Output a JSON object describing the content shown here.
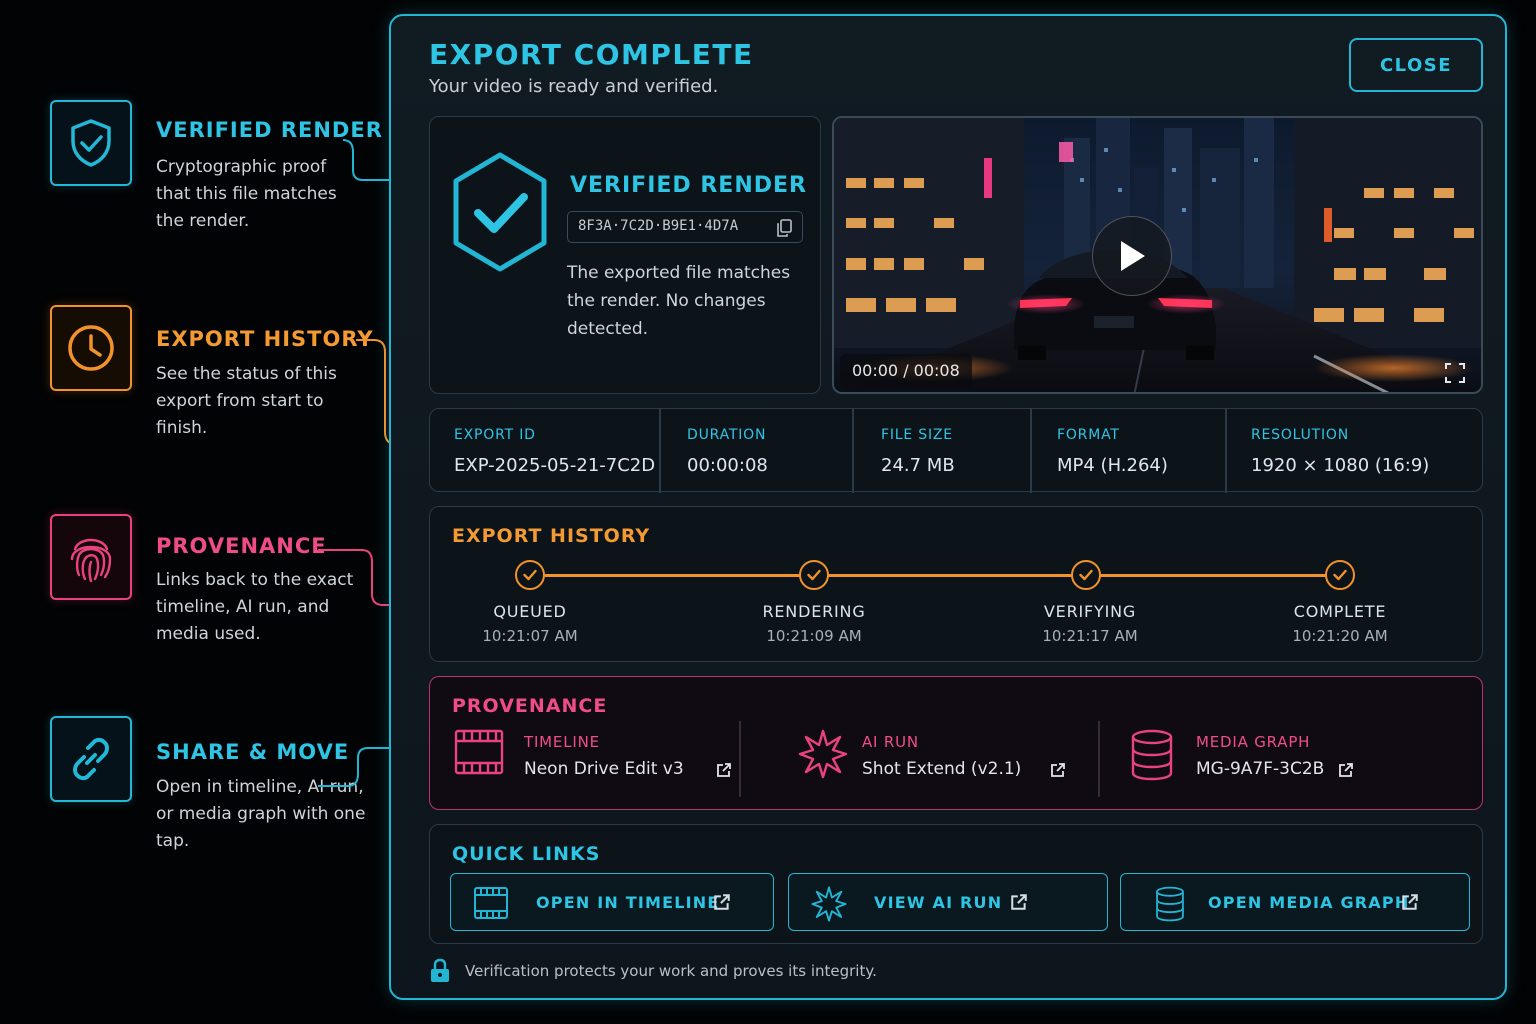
{
  "colors": {
    "cyan": "#22b6d4",
    "orange": "#f2922a",
    "pink": "#e8437e",
    "panel_bg": "#111b22",
    "page_bg": "#020304"
  },
  "annotations": [
    {
      "icon": "shield-check-icon",
      "title": "VERIFIED RENDER",
      "body": "Cryptographic proof that this file matches the render."
    },
    {
      "icon": "clock-icon",
      "title": "EXPORT HISTORY",
      "body": "See the status of this export from start to finish."
    },
    {
      "icon": "fingerprint-icon",
      "title": "PROVENANCE",
      "body": "Links back to the exact timeline, AI run, and media used."
    },
    {
      "icon": "link-icon",
      "title": "SHARE & MOVE",
      "body": "Open in timeline, AI run, or media graph with one tap."
    }
  ],
  "panel": {
    "title": "EXPORT COMPLETE",
    "subtitle": "Your video is ready and verified.",
    "close_label": "CLOSE"
  },
  "verified": {
    "title": "VERIFIED RENDER",
    "hash": "8F3A·7C2D·B9E1·4D7A",
    "description": "The exported file matches the render. No changes detected."
  },
  "video": {
    "timecode": "00:00 / 00:08",
    "progress": 0
  },
  "stats": [
    {
      "key": "EXPORT ID",
      "value": "EXP-2025-05-21-7C2D"
    },
    {
      "key": "DURATION",
      "value": "00:00:08"
    },
    {
      "key": "FILE SIZE",
      "value": "24.7 MB"
    },
    {
      "key": "FORMAT",
      "value": "MP4 (H.264)"
    },
    {
      "key": "RESOLUTION",
      "value": "1920 × 1080 (16:9)"
    }
  ],
  "history": {
    "title": "EXPORT HISTORY",
    "steps": [
      {
        "label": "QUEUED",
        "time": "10:21:07 AM"
      },
      {
        "label": "RENDERING",
        "time": "10:21:09 AM"
      },
      {
        "label": "VERIFYING",
        "time": "10:21:17 AM"
      },
      {
        "label": "COMPLETE",
        "time": "10:21:20 AM"
      }
    ]
  },
  "provenance": {
    "title": "PROVENANCE",
    "items": [
      {
        "icon": "film-strip-icon",
        "key": "TIMELINE",
        "value": "Neon Drive Edit v3"
      },
      {
        "icon": "sparkle-burst-icon",
        "key": "AI RUN",
        "value": "Shot Extend (v2.1)"
      },
      {
        "icon": "database-icon",
        "key": "MEDIA GRAPH",
        "value": "MG-9A7F-3C2B"
      }
    ]
  },
  "quick_links": {
    "title": "QUICK LINKS",
    "buttons": [
      {
        "icon": "film-strip-icon",
        "label": "OPEN IN TIMELINE"
      },
      {
        "icon": "sparkle-burst-icon",
        "label": "VIEW AI RUN"
      },
      {
        "icon": "database-icon",
        "label": "OPEN MEDIA GRAPH"
      }
    ]
  },
  "footer": {
    "icon": "lock-icon",
    "text": "Verification protects your work and proves its integrity."
  }
}
